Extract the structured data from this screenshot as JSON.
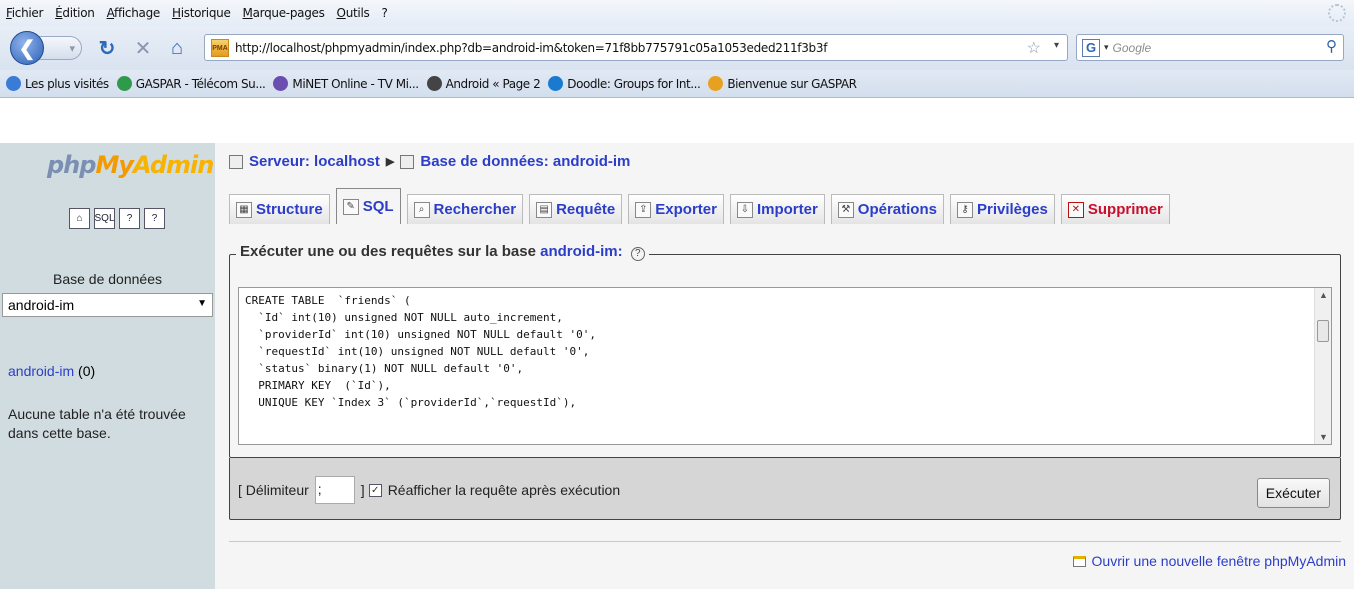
{
  "menu": [
    "Fichier",
    "Édition",
    "Affichage",
    "Historique",
    "Marque-pages",
    "Outils",
    "?"
  ],
  "url": "http://localhost/phpmyadmin/index.php?db=android-im&token=71f8bb775791c05a1053eded211f3b3f",
  "favicon_text": "PMA",
  "search_placeholder": "Google",
  "bookmarks": [
    {
      "label": "Les plus visités",
      "color": "#3a7bd5"
    },
    {
      "label": "GASPAR - Télécom Su...",
      "color": "#2f9a4a"
    },
    {
      "label": "MiNET Online - TV Mi...",
      "color": "#6a4fb0"
    },
    {
      "label": "Android « Page 2",
      "color": "#444444"
    },
    {
      "label": "Doodle: Groups for Int...",
      "color": "#1a7ad0"
    },
    {
      "label": "Bienvenue sur GASPAR",
      "color": "#e8a020"
    }
  ],
  "left": {
    "logo_php": "php",
    "logo_my": "My",
    "logo_admin": "Admin",
    "icons": [
      "home-icon",
      "sql-query-icon",
      "docs-icon",
      "help-docs-icon"
    ],
    "db_label": "Base de données",
    "db_selected": "android-im",
    "db_link": "android-im",
    "db_count": "(0)",
    "no_table": "Aucune table n'a été trouvée dans cette base."
  },
  "breadcrumb": {
    "server": "Serveur: localhost",
    "database": "Base de données: android-im"
  },
  "tabs": [
    {
      "label": "Structure",
      "icon": "structure-icon",
      "glyph": "▦"
    },
    {
      "label": "SQL",
      "icon": "sql-icon",
      "glyph": "✎",
      "active": true
    },
    {
      "label": "Rechercher",
      "icon": "search-icon",
      "glyph": "⌕"
    },
    {
      "label": "Requête",
      "icon": "query-icon",
      "glyph": "▤"
    },
    {
      "label": "Exporter",
      "icon": "export-icon",
      "glyph": "⇪"
    },
    {
      "label": "Importer",
      "icon": "import-icon",
      "glyph": "⇩"
    },
    {
      "label": "Opérations",
      "icon": "operations-icon",
      "glyph": "⚒"
    },
    {
      "label": "Privilèges",
      "icon": "privileges-icon",
      "glyph": "⚷"
    },
    {
      "label": "Supprimer",
      "icon": "delete-icon",
      "glyph": "✕",
      "danger": true
    }
  ],
  "sql": {
    "legend_prefix": "Exécuter une ou des requêtes sur la base ",
    "legend_db": "android-im:",
    "query": "CREATE TABLE  `friends` (\n  `Id` int(10) unsigned NOT NULL auto_increment,\n  `providerId` int(10) unsigned NOT NULL default '0',\n  `requestId` int(10) unsigned NOT NULL default '0',\n  `status` binary(1) NOT NULL default '0',\n  PRIMARY KEY  (`Id`),\n  UNIQUE KEY `Index 3` (`providerId`,`requestId`),"
  },
  "exec": {
    "delimiter_label": "[ Délimiteur",
    "delimiter_value": ";",
    "bracket_close": "]",
    "reshow_label": "Réafficher la requête après exécution",
    "reshow_checked": true,
    "button": "Exécuter"
  },
  "new_window": "Ouvrir une nouvelle fenêtre phpMyAdmin"
}
